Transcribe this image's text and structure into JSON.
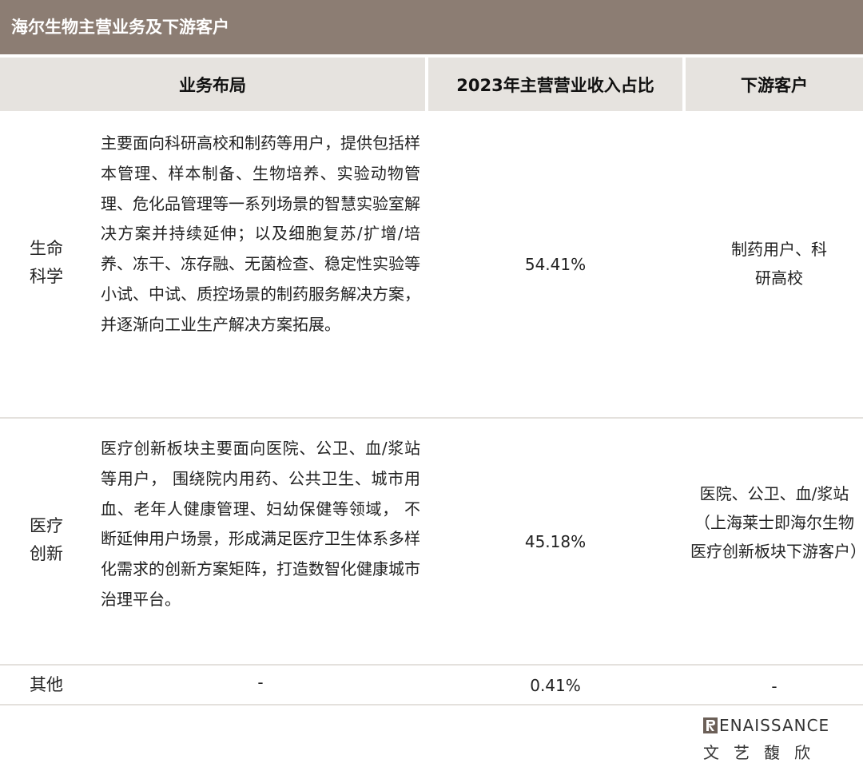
{
  "title": "海尔生物主营业务及下游客户",
  "headers": {
    "business": "业务布局",
    "revenue_share": "2023年主营营业收入占比",
    "customers": "下游客户"
  },
  "rows": [
    {
      "category": "生命科学",
      "description": "主要面向科研高校和制药等用户，提供包括样本管理、样本制备、生物培养、实验动物管理、危化品管理等一系列场景的智慧实验室解决方案并持续延伸；以及细胞复苏/扩增/培养、冻干、冻存融、无菌检查、稳定性实验等小试、中试、质控场景的制药服务解决方案，并逐渐向工业生产解决方案拓展。",
      "share": "54.41%",
      "customers": "制药用户、科研高校"
    },
    {
      "category": "医疗创新",
      "description": "医疗创新板块主要面向医院、公卫、血/浆站等用户， 围绕院内用药、公共卫生、城市用血、老年人健康管理、妇幼保健等领域， 不断延伸用户场景，形成满足医疗卫生体系多样化需求的创新方案矩阵，打造数智化健康城市治理平台。",
      "share": "45.18%",
      "customers": "医院、公卫、血/浆站（上海莱士即海尔生物医疗创新板块下游客户）"
    },
    {
      "category": "其他",
      "description": "-",
      "share": "0.41%",
      "customers": "-"
    }
  ],
  "logo": {
    "english": "ENAISSANCE",
    "chinese": "文艺馥欣",
    "mark_icon": "renaissance-r-mark-icon"
  },
  "colors": {
    "title_bg": "#8c7d73",
    "header_bg": "#e6e3df",
    "divider": "#e4e1dd"
  }
}
